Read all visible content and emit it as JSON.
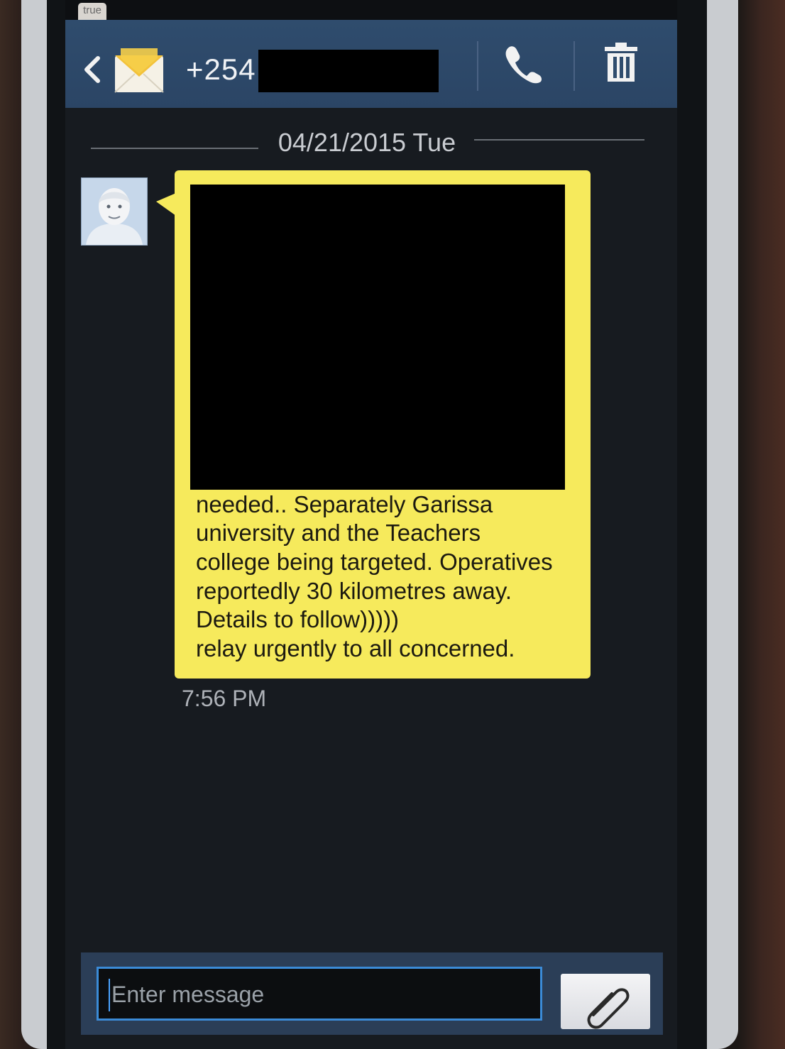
{
  "status_bar": {
    "carrier_label": "true",
    "right_text": ""
  },
  "header": {
    "contact_number": "+254"
  },
  "conversation": {
    "date_label": "04/21/2015 Tue",
    "message": {
      "lines": [
        "needed..  Separately Garissa",
        "university and the Teachers",
        "college being targeted. Operatives",
        "reportedly 30 kilometres away.",
        "Details to follow)))))",
        "relay  urgently to all concerned."
      ],
      "time": "7:56 PM",
      "bubble_color": "#f6ea5c"
    }
  },
  "composer": {
    "placeholder": "Enter message"
  },
  "colors": {
    "title_bar": "#2f4c6d",
    "input_border": "#3b8bd7"
  }
}
